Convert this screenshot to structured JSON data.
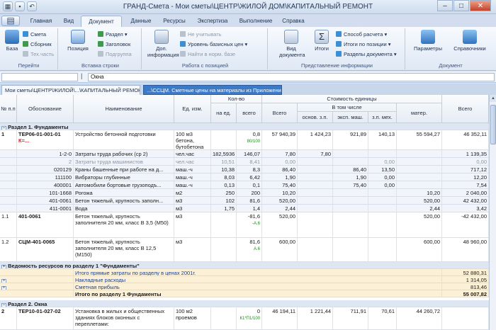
{
  "window": {
    "title": "ГРАНД-Смета - Мои сметы\\ЦЕНТР\\ЖИЛОЙ ДОМ\\КАПИТАЛЬНЫЙ РЕМОНТ"
  },
  "menu_tabs": [
    "Главная",
    "Вид",
    "Документ",
    "Данные",
    "Ресурсы",
    "Экспертиза",
    "Выполнение",
    "Справка"
  ],
  "ribbon": {
    "pereyti": {
      "base": "База",
      "smeta": "Смета",
      "sbornik": "Сборник",
      "tehchast": "Тех.часть",
      "label": "Перейти"
    },
    "vstavka": {
      "position": "Позиция",
      "razdel": "Раздел",
      "zagolovok": "Заголовок",
      "podgruppa": "Подгруппа",
      "label": "Вставка строки"
    },
    "rabota": {
      "dop": "Доп. информация",
      "ne_uchit": "Не учитывать",
      "uroven": "Уровень базисных цен",
      "naiti": "Найти в норм. базе",
      "label": "Работа с позицией"
    },
    "predst": {
      "vid": "Вид документа",
      "itogi": "Итоги",
      "sposob": "Способ расчета",
      "itogi_poz": "Итоги по позиции",
      "razdely": "Разделы документа",
      "label": "Представление информации"
    },
    "doc": {
      "params": "Параметры",
      "sprav": "Справочники",
      "label": "Документ"
    }
  },
  "formula_bar": {
    "value": "Окна"
  },
  "doc_tabs": [
    "Мои сметы\\ЦЕНТР\\ЖИЛОЙ\\...\\КАПИТАЛЬНЫЙ РЕМОНТ",
    "...\\ССЦМ. Сметные цены на материалы из Приложений"
  ],
  "header": {
    "num": "№ п.п",
    "obosn": "Обоснование",
    "name": "Наименование",
    "unit": "Ед. изм.",
    "qty": "Кол-во",
    "qty_unit": "на ед.",
    "qty_total": "всего",
    "cost": "Стоимость единицы",
    "cost_total": "Всего",
    "incl": "В том числе",
    "osn": "основ. з.п.",
    "eksp": "эксп. маш.",
    "zp_meh": "з.п. мех.",
    "mater": "матер.",
    "vsego": "Всего"
  },
  "rows": [
    {
      "type": "sec",
      "text": "Раздел 1. Фундаменты"
    },
    {
      "type": "main",
      "num": "1",
      "code": "ТЕР06-01-001-01",
      "code2": "К=...",
      "name": "Устройство бетонной подготовки",
      "unit": "100 м3 бетона, бутобетона",
      "qty_unit": "",
      "qty_total": "0,8",
      "qty_note": "80/100",
      "total": "57 940,39",
      "osn": "1 424,23",
      "eksp": "921,89",
      "zpmeh": "140,13",
      "mater": "55 594,27",
      "vsego": "46 352,11"
    },
    {
      "type": "sub",
      "num": "",
      "code": "1-2-0",
      "name": "Затраты труда рабочих (ср 2)",
      "unit": "чел.час",
      "qty_unit": "182,5936",
      "qty_total": "146,07",
      "total": "7,80",
      "osn": "7,80",
      "eksp": "",
      "zpmeh": "",
      "mater": "",
      "vsego": "1 139,35"
    },
    {
      "type": "sub",
      "code": "2",
      "name": "Затраты труда машинистов",
      "unit": "чел.час",
      "qty_unit": "10,51",
      "qty_total": "8,41",
      "total": "0,00",
      "osn": "",
      "eksp": "",
      "zpmeh": "0,00",
      "mater": "",
      "vsego": "0,00"
    },
    {
      "type": "sub",
      "code": "020129",
      "name": "Краны башенные при работе на д...",
      "unit": "маш.-ч",
      "qty_unit": "10,38",
      "qty_total": "8,3",
      "total": "86,40",
      "osn": "",
      "eksp": "86,40",
      "zpmeh": "13,50",
      "mater": "",
      "vsego": "717,12"
    },
    {
      "type": "sub",
      "code": "111100",
      "name": "Вибраторы глубинные",
      "unit": "маш.-ч",
      "qty_unit": "8,03",
      "qty_total": "6,42",
      "total": "1,90",
      "osn": "",
      "eksp": "1,90",
      "zpmeh": "0,00",
      "mater": "",
      "vsego": "12,20"
    },
    {
      "type": "sub",
      "code": "400001",
      "name": "Автомобили бортовые грузоподъ...",
      "unit": "маш.-ч",
      "qty_unit": "0,13",
      "qty_total": "0,1",
      "total": "75,40",
      "osn": "",
      "eksp": "75,40",
      "zpmeh": "0,00",
      "mater": "",
      "vsego": "7,54"
    },
    {
      "type": "sub",
      "code": "101-1668",
      "name": "Рогожа",
      "unit": "м2",
      "qty_unit": "250",
      "qty_total": "200",
      "total": "10,20",
      "osn": "",
      "eksp": "",
      "zpmeh": "",
      "mater": "10,20",
      "vsego": "2 040,00"
    },
    {
      "type": "sub",
      "code": "401-0061",
      "name": "Бетон тяжелый, крупность заполн...",
      "unit": "м3",
      "qty_unit": "102",
      "qty_total": "81,6",
      "total": "520,00",
      "osn": "",
      "eksp": "",
      "zpmeh": "",
      "mater": "520,00",
      "vsego": "42 432,00"
    },
    {
      "type": "sub",
      "code": "411-0001",
      "name": "Вода",
      "unit": "м3",
      "qty_unit": "1,75",
      "qty_total": "1,4",
      "total": "2,44",
      "osn": "",
      "eksp": "",
      "zpmeh": "",
      "mater": "2,44",
      "vsego": "3,42"
    },
    {
      "type": "mat",
      "num": "1.1",
      "code": "401-0061",
      "name": "Бетон тяжелый, крупность заполнителя 20 мм, класс В 3,5 (М50)",
      "unit": "м3",
      "qty_total": "-81,6",
      "qty_note": "-А.6",
      "total": "520,00",
      "mater": "520,00",
      "vsego": "-42 432,00"
    },
    {
      "type": "mat",
      "num": "1.2",
      "code": "СЦМ-401-0065",
      "name": "Бетон тяжелый, крупность заполнителя 20 мм, класс В 12,5 (М150)",
      "unit": "м3",
      "qty_total": "81,6",
      "qty_note": "А.6",
      "total": "600,00",
      "mater": "600,00",
      "vsego": "48 960,00"
    },
    {
      "type": "sec",
      "text": "Ведомость ресурсов по разделу 1 \"Фундаменты\""
    },
    {
      "type": "tot",
      "text": "Итого прямые затраты по разделу в ценах 2001г.",
      "vsego": "52 880,31"
    },
    {
      "type": "tot",
      "text": "Накладные расходы",
      "vsego": "1 314,05"
    },
    {
      "type": "tot",
      "text": "Сметная прибыль",
      "vsego": "813,46"
    },
    {
      "type": "totb",
      "text": "Итого по разделу 1 Фундаменты",
      "vsego": "55 007,82"
    },
    {
      "type": "sec",
      "text": "Раздел 2. Окна"
    },
    {
      "type": "main",
      "num": "2",
      "code": "ТЕР10-01-027-02",
      "code2": "",
      "name": "Установка в жилых и общественных зданиях блоков оконных с переплетами:",
      "unit": "100 м2 проемов",
      "qty_unit": "",
      "qty_total": "0",
      "qty_note": "К1*П1/100",
      "total": "46 194,11",
      "osn": "1 221,44",
      "eksp": "711,91",
      "zpmeh": "70,61",
      "mater": "44 260,72",
      "vsego": ""
    }
  ]
}
